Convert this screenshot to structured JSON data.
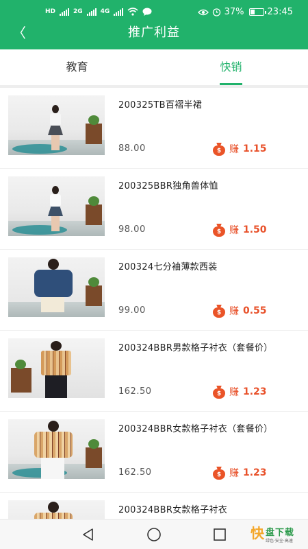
{
  "status_bar": {
    "left_labels": [
      "HD",
      "2G",
      "4G"
    ],
    "battery_percent": "37%",
    "battery_level": 0.37,
    "time": "23:45",
    "icons": [
      "eye-icon",
      "alarm-icon",
      "battery-icon",
      "wifi-icon",
      "message-icon"
    ]
  },
  "header": {
    "back_glyph": "〈",
    "title": "推广利益",
    "background": "#21b26b"
  },
  "tabs": [
    {
      "label": "教育",
      "active": false
    },
    {
      "label": "快销",
      "active": true
    }
  ],
  "products": [
    {
      "name": "200325TB百褶半裙",
      "price": "88.00",
      "earn_label": "赚",
      "earn_amount": "1.15"
    },
    {
      "name": "200325BBR独角兽体恤",
      "price": "98.00",
      "earn_label": "赚",
      "earn_amount": "1.50"
    },
    {
      "name": "200324七分袖薄款西装",
      "price": "99.00",
      "earn_label": "赚",
      "earn_amount": "0.55"
    },
    {
      "name": "200324BBR男款格子衬衣（套餐价）",
      "price": "162.50",
      "earn_label": "赚",
      "earn_amount": "1.23"
    },
    {
      "name": "200324BBR女款格子衬衣（套餐价）",
      "price": "162.50",
      "earn_label": "赚",
      "earn_amount": "1.23"
    },
    {
      "name": "200324BBR女款格子衬衣",
      "price": "",
      "earn_label": "",
      "earn_amount": ""
    }
  ],
  "colors": {
    "accent": "#21b26b",
    "earn": "#e8512a"
  },
  "brand": {
    "mark": "快",
    "name": "盘下载",
    "slogan": "绿色·安全·高速"
  },
  "nav": {
    "icons": [
      "back-triangle-icon",
      "home-circle-icon",
      "recent-square-icon"
    ]
  }
}
